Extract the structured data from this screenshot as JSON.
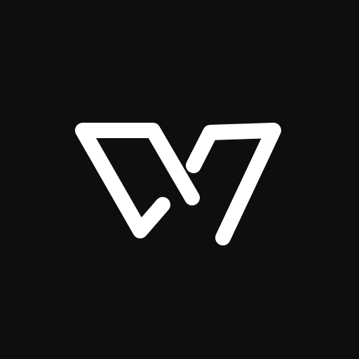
{
  "icon": {
    "name": "w-monogram-logo-icon"
  },
  "colors": {
    "background": "#0e0e0d",
    "logo_stroke": "#ffffff"
  }
}
